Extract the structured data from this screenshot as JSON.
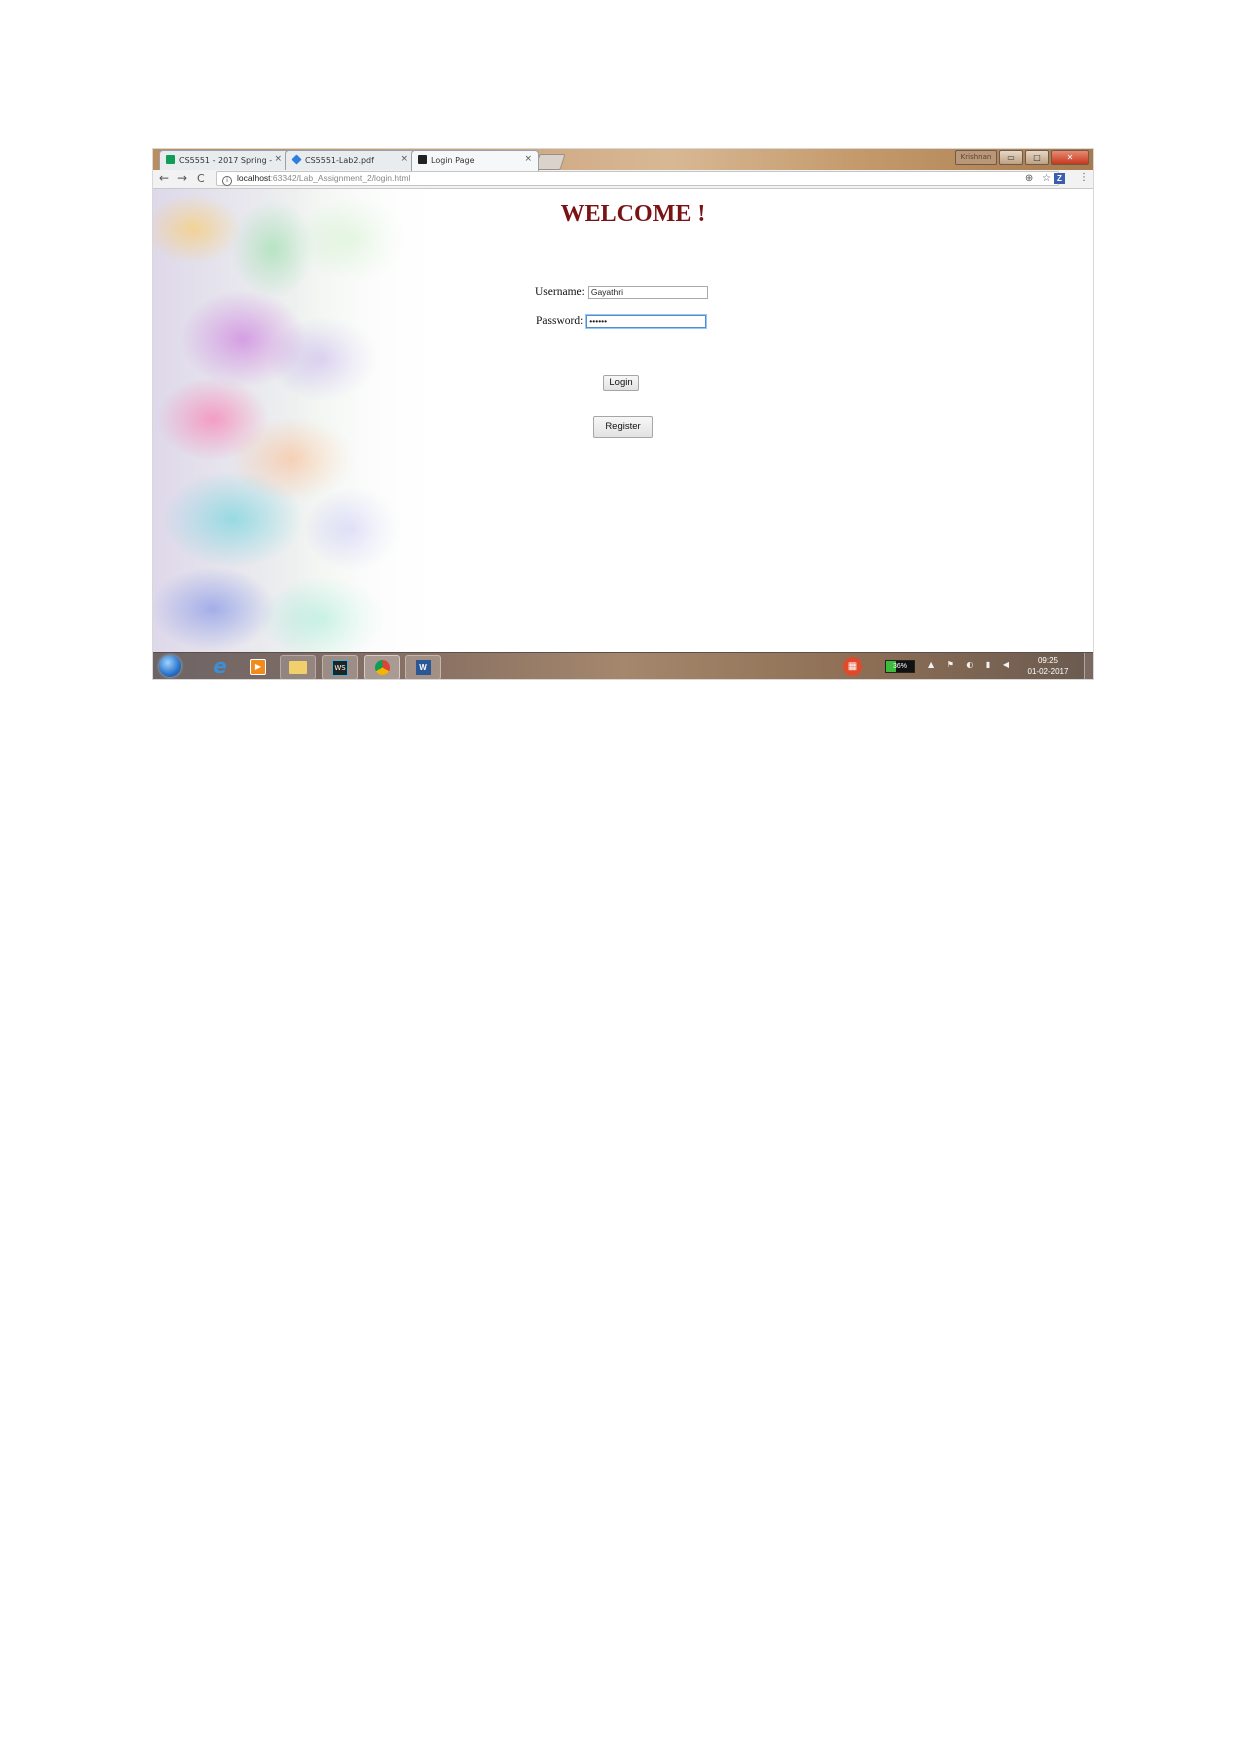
{
  "browser": {
    "tabs": [
      {
        "title": "CS5551 - 2017 Spring - ",
        "close": "×",
        "icon": "sheets-icon",
        "active": false,
        "favicon_color": "#0f9d58"
      },
      {
        "title": "CS5551-Lab2.pdf",
        "close": "×",
        "icon": "dropbox-icon",
        "active": false,
        "favicon_color": "#2e7de1"
      },
      {
        "title": "Login Page",
        "close": "×",
        "icon": "webstorm-icon",
        "active": true,
        "favicon_color": "#222222"
      }
    ],
    "window_user": "Krishnan",
    "nav": {
      "back": "←",
      "forward": "→",
      "reload": "C"
    },
    "url": {
      "host": "localhost",
      "path": ":63342/Lab_Assignment_2/login.html"
    },
    "omnibox_right": "⊕ ☆",
    "extension_label": "Z",
    "menu": "⋮"
  },
  "page": {
    "heading": "WELCOME !",
    "username_label": "Username:",
    "username_value": "Gayathri",
    "password_label": "Password:",
    "password_value": "••••••",
    "login_label": "Login",
    "register_label": "Register"
  },
  "taskbar": {
    "apps": [
      "start",
      "internet-explorer",
      "media-player",
      "file-explorer",
      "webstorm",
      "chrome",
      "word"
    ],
    "webstorm_label": "WS",
    "word_label": "W",
    "battery_percent": 36,
    "battery_label": "36%",
    "clock_time": "09:25",
    "clock_date": "01-02-2017"
  },
  "colors": {
    "heading": "#7a1414",
    "focus_border": "#4a90d9",
    "battery_fill": "#3dbb3d"
  }
}
